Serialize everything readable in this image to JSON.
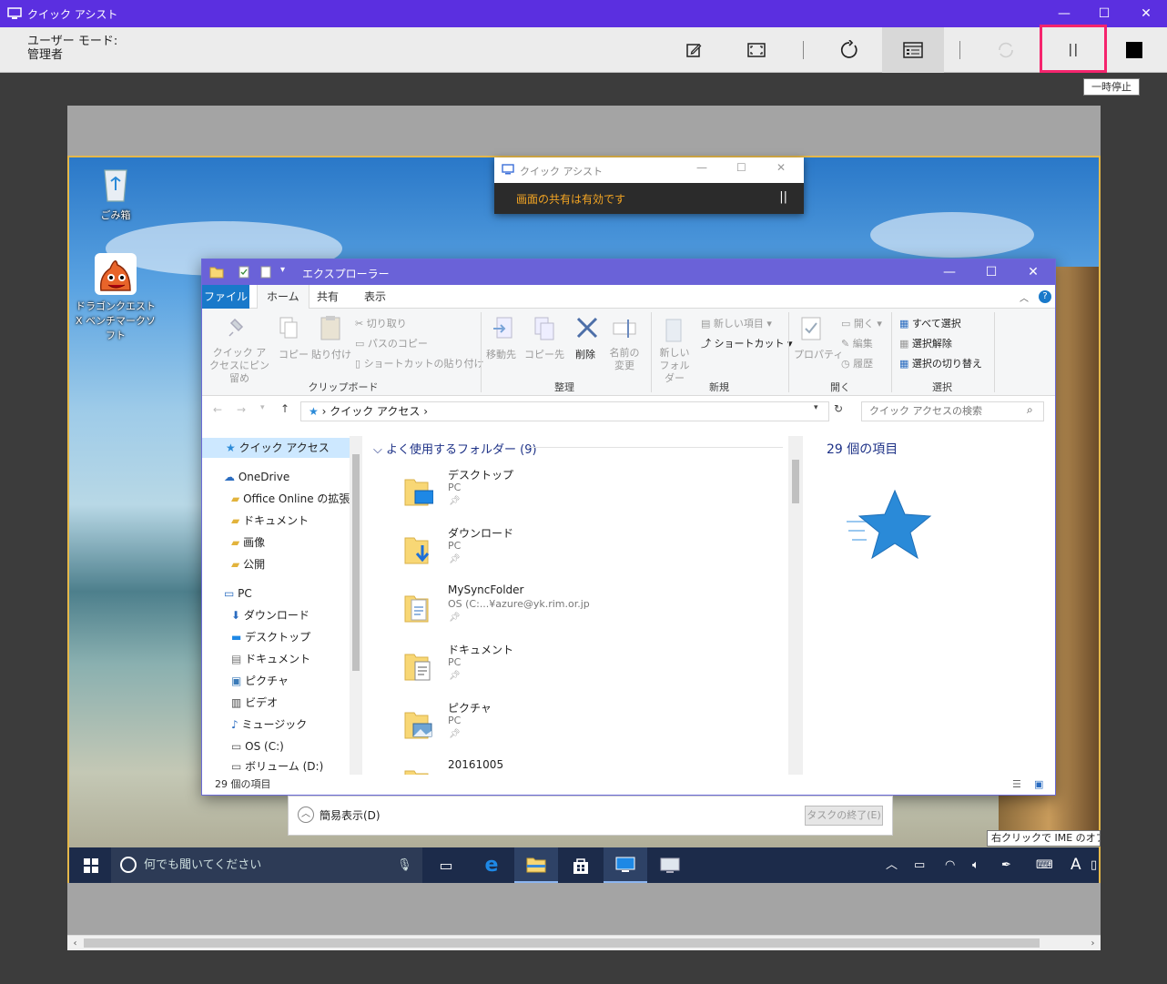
{
  "window": {
    "title": "クイック アシスト",
    "minimize": "—",
    "maximize": "☐",
    "close": "✕"
  },
  "toolbar": {
    "mode_line1": "ユーザー モード:",
    "mode_line2": "管理者",
    "pause_tooltip": "一時停止"
  },
  "share_panel": {
    "title": "クイック アシスト",
    "message": "画面の共有は有効です",
    "pause": "||"
  },
  "desktop_icons": [
    {
      "label": "ごみ箱"
    },
    {
      "label": "ドラゴンクエストX ベンチマークソフト"
    }
  ],
  "explorer": {
    "title": "エクスプローラー",
    "tabs": [
      "ファイル",
      "ホーム",
      "共有",
      "表示"
    ],
    "ribbon": {
      "pin": "クイック アクセスにピン留め",
      "copy": "コピー",
      "paste": "貼り付け",
      "cut": "切り取り",
      "copy_path": "パスのコピー",
      "paste_shortcut": "ショートカットの貼り付け",
      "clipboard": "クリップボード",
      "move_to": "移動先",
      "copy_to": "コピー先",
      "delete": "削除",
      "rename": "名前の変更",
      "organize": "整理",
      "new_folder": "新しいフォルダー",
      "new_item": "新しい項目",
      "shortcut": "ショートカット",
      "new": "新規",
      "properties": "プロパティ",
      "open": "開く",
      "edit": "編集",
      "history": "履歴",
      "open_group": "開く",
      "select_all": "すべて選択",
      "select_none": "選択解除",
      "invert": "選択の切り替え",
      "select": "選択"
    },
    "address": "クイック アクセス",
    "search_placeholder": "クイック アクセスの検索",
    "nav": [
      "クイック アクセス",
      "OneDrive",
      "Office Online の拡張",
      "ドキュメント",
      "画像",
      "公開",
      "PC",
      "ダウンロード",
      "デスクトップ",
      "ドキュメント",
      "ピクチャ",
      "ビデオ",
      "ミュージック",
      "OS (C:)",
      "ボリューム (D:)"
    ],
    "group_header": "よく使用するフォルダー (9)",
    "folders": [
      {
        "name": "デスクトップ",
        "sub": "PC"
      },
      {
        "name": "ダウンロード",
        "sub": "PC"
      },
      {
        "name": "MySyncFolder",
        "sub": "OS (C:...¥azure@yk.rim.or.jp"
      },
      {
        "name": "ドキュメント",
        "sub": "PC"
      },
      {
        "name": "ピクチャ",
        "sub": "PC"
      },
      {
        "name": "20161005",
        "sub": ""
      }
    ],
    "details_count": "29 個の項目",
    "status": "29 個の項目"
  },
  "taskmgr": {
    "simple": "簡易表示(D)",
    "end_task": "タスクの終了(E)"
  },
  "ime_tooltip": "右クリックで IME のオプション",
  "taskbar": {
    "search_placeholder": "何でも聞いてください",
    "ime_mode": "A"
  },
  "colors": {
    "titlebar": "#5b2fe0",
    "highlight": "#f5246d",
    "explorer_title": "#6a62d8",
    "file_tab": "#1979ca"
  }
}
